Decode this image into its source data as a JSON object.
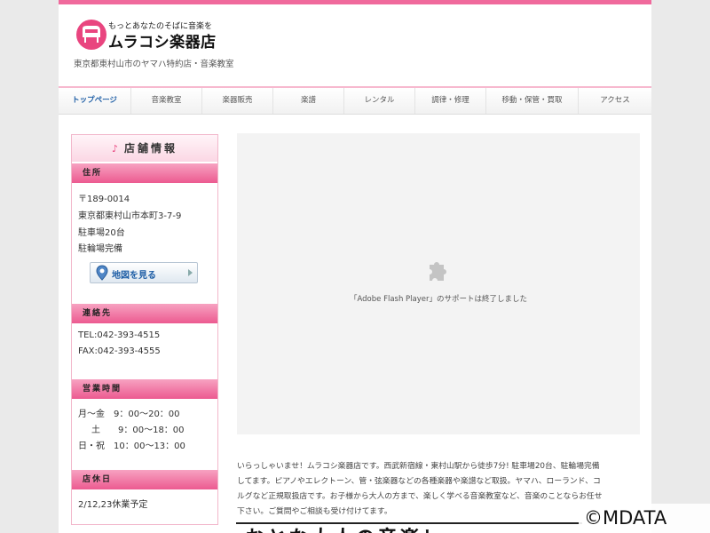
{
  "header": {
    "tagline": "もっとあなたのそばに音楽を",
    "store_name": "ムラコシ楽器店",
    "subtitle": "東京都東村山市のヤマハ特約店・音楽教室"
  },
  "nav": {
    "items": [
      {
        "label": "トップページ"
      },
      {
        "label": "音楽教室"
      },
      {
        "label": "楽器販売"
      },
      {
        "label": "楽譜"
      },
      {
        "label": "レンタル"
      },
      {
        "label": "調律・修理"
      },
      {
        "label": "移動・保管・買取"
      },
      {
        "label": "アクセス"
      }
    ]
  },
  "sidebar": {
    "heading": "店舗情報",
    "heading_icon": "music-note-icon",
    "address": {
      "title": "住所",
      "lines": [
        "〒189-0014",
        "東京都東村山市本町3-7-9",
        "駐車場20台",
        "駐輪場完備"
      ],
      "map_button": "地図を見る"
    },
    "contact": {
      "title": "連絡先",
      "tel": "TEL:042-393-4515",
      "fax": "FAX:042-393-4555"
    },
    "hours": {
      "title": "営業時間",
      "lines": [
        "月～金　9：00～20：00",
        "土　　9：00～18：00",
        "日・祝　10：00～13：00"
      ]
    },
    "closed": {
      "title": "店休日",
      "text": "2/12,23休業予定"
    }
  },
  "main": {
    "flash_message": "「Adobe Flash Player」のサポートは終了しました",
    "intro_lines": [
      "いらっしゃいませ！ムラコシ楽器店です。西武新宿線・東村山駅から徒歩7分! 駐車場20台、駐輪場完備",
      "してます。ピアノやエレクトーン、管・弦楽器などの各種楽器や楽譜など取扱。ヤマハ、ローランド、コ",
      "ルグなど正規取扱店です。お子様から大人の方まで、楽しく学べる音楽教室など、音楽のことならお任せ",
      "下さい。ご質問やご相談も受け付けてます。"
    ],
    "banner_text": "おとな大人の音楽レ"
  },
  "watermark": "©MDATA",
  "colors": {
    "accent_pink": "#e9457f",
    "nav_active": "#1f5fa6"
  }
}
